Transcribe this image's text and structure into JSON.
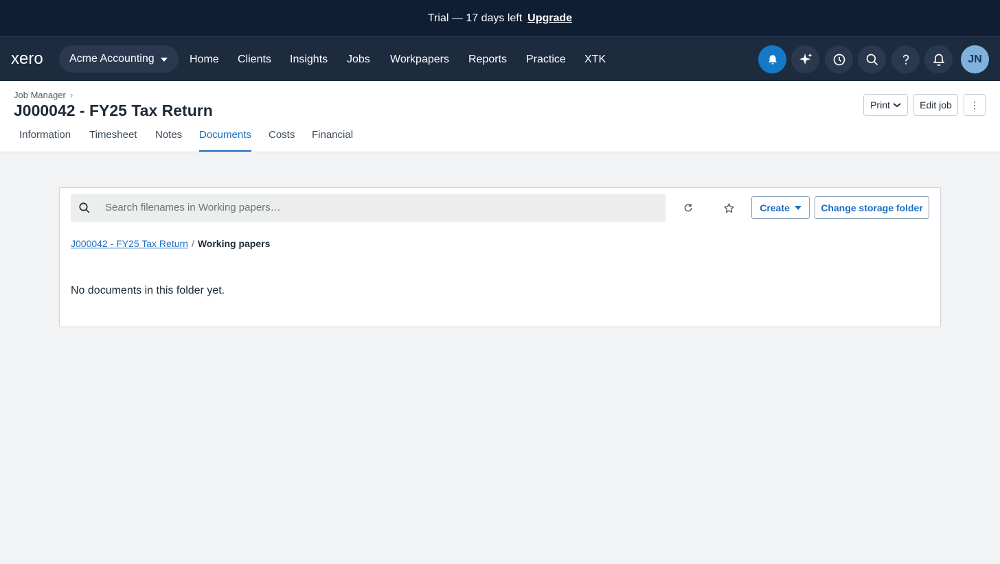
{
  "trial": {
    "text": "Trial — 17 days left",
    "upgrade": "Upgrade"
  },
  "nav": {
    "logo": "xero",
    "org": "Acme Accounting",
    "items": [
      "Home",
      "Clients",
      "Insights",
      "Jobs",
      "Workpapers",
      "Reports",
      "Practice",
      "XTK"
    ],
    "icons": [
      "notification-bell-icon",
      "ai-sparkle-icon",
      "history-clock-icon",
      "search-icon",
      "help-icon",
      "bell-icon"
    ],
    "avatar": "JN"
  },
  "header": {
    "breadcrumb": "Job Manager",
    "title": "J000042 - FY25 Tax Return",
    "tabs": [
      "Information",
      "Timesheet",
      "Notes",
      "Documents",
      "Costs",
      "Financial"
    ],
    "active_tab": "Documents",
    "print": "Print",
    "edit_job": "Edit job",
    "more": "⋮"
  },
  "documents": {
    "search_placeholder": "Search filenames in Working papers…",
    "create": "Create",
    "change_folder": "Change storage folder",
    "path_root": "J000042 - FY25 Tax Return",
    "path_sep": "/",
    "path_current": "Working papers",
    "empty": "No documents in this folder yet."
  },
  "colors": {
    "accent": "#1c6dbf",
    "nav_bg": "#1d2b3f",
    "trial_bg": "#0f1e33",
    "page_bg": "#f2f3f4"
  }
}
